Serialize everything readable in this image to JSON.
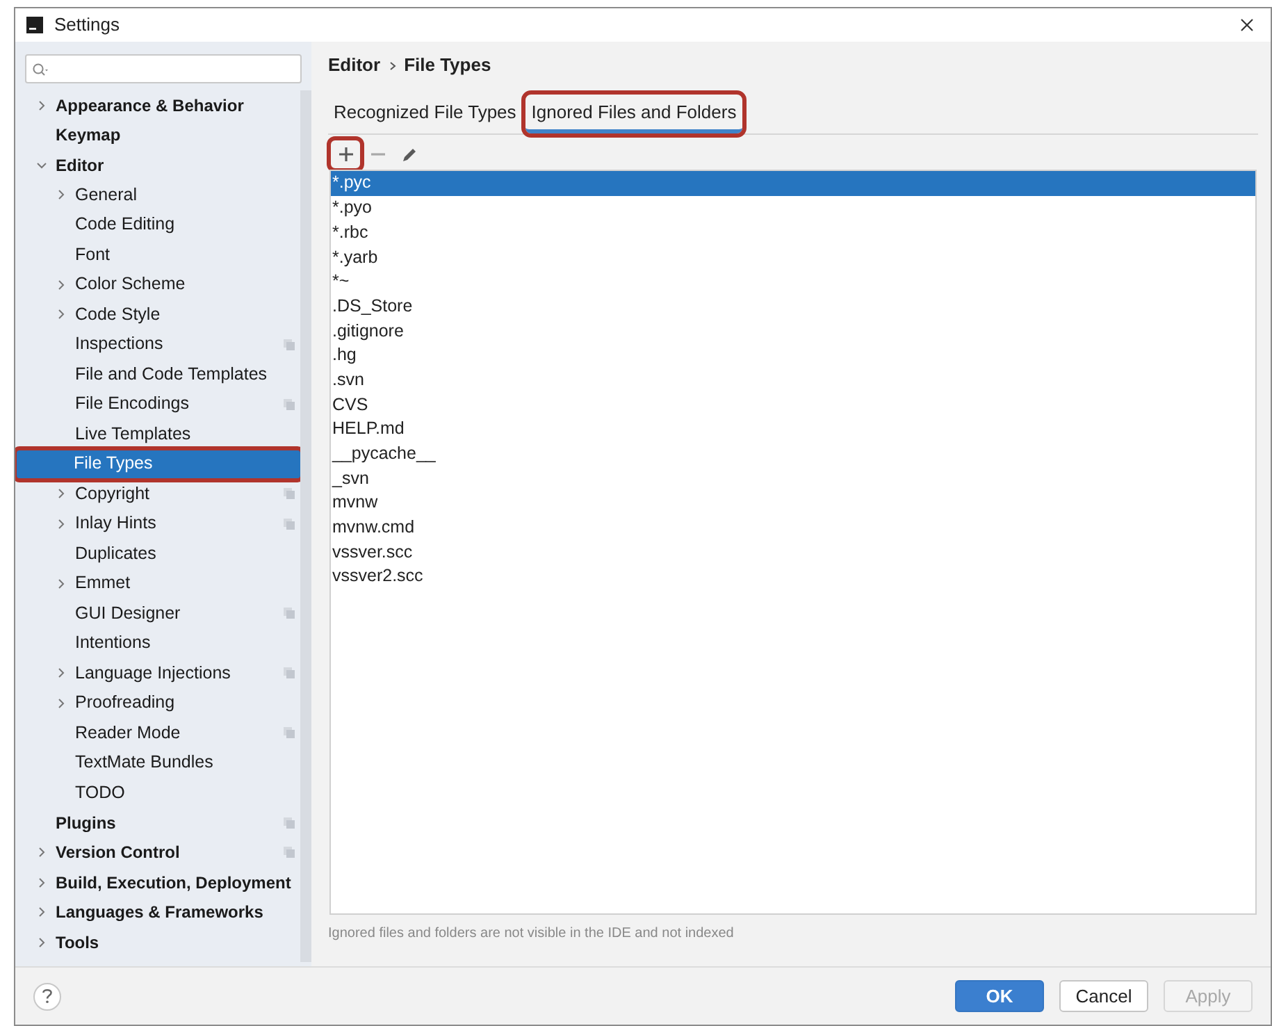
{
  "window": {
    "title": "Settings"
  },
  "sidebar": {
    "items": [
      {
        "label": "Appearance & Behavior",
        "bold": true,
        "expanded": false
      },
      {
        "label": "Keymap",
        "bold": true
      },
      {
        "label": "Editor",
        "bold": true,
        "expanded": true,
        "children": [
          {
            "label": "General",
            "expanded": false
          },
          {
            "label": "Code Editing"
          },
          {
            "label": "Font"
          },
          {
            "label": "Color Scheme",
            "expanded": false
          },
          {
            "label": "Code Style",
            "expanded": false
          },
          {
            "label": "Inspections",
            "project_icon": true
          },
          {
            "label": "File and Code Templates"
          },
          {
            "label": "File Encodings",
            "project_icon": true
          },
          {
            "label": "Live Templates"
          },
          {
            "label": "File Types",
            "selected": true,
            "annotated": true
          },
          {
            "label": "Copyright",
            "expanded": false,
            "project_icon": true
          },
          {
            "label": "Inlay Hints",
            "expanded": false,
            "project_icon": true
          },
          {
            "label": "Duplicates"
          },
          {
            "label": "Emmet",
            "expanded": false
          },
          {
            "label": "GUI Designer",
            "project_icon": true
          },
          {
            "label": "Intentions"
          },
          {
            "label": "Language Injections",
            "expanded": false,
            "project_icon": true
          },
          {
            "label": "Proofreading",
            "expanded": false
          },
          {
            "label": "Reader Mode",
            "project_icon": true
          },
          {
            "label": "TextMate Bundles"
          },
          {
            "label": "TODO"
          }
        ]
      },
      {
        "label": "Plugins",
        "bold": true,
        "project_icon": true
      },
      {
        "label": "Version Control",
        "bold": true,
        "expanded": false,
        "project_icon": true
      },
      {
        "label": "Build, Execution, Deployment",
        "bold": true,
        "expanded": false
      },
      {
        "label": "Languages & Frameworks",
        "bold": true,
        "expanded": false
      },
      {
        "label": "Tools",
        "bold": true,
        "expanded": false
      }
    ]
  },
  "breadcrumb": [
    "Editor",
    "File Types"
  ],
  "tabs": [
    {
      "label": "Recognized File Types",
      "selected": false,
      "annotated": false
    },
    {
      "label": "Ignored Files and Folders",
      "selected": true,
      "annotated": true
    }
  ],
  "toolbar": [
    {
      "kind": "add",
      "disabled": false,
      "annotated": true
    },
    {
      "kind": "remove",
      "disabled": true,
      "annotated": false
    },
    {
      "kind": "edit",
      "disabled": false,
      "annotated": false
    }
  ],
  "patterns": [
    {
      "text": "*.pyc",
      "selected": true
    },
    {
      "text": "*.pyo",
      "selected": false
    },
    {
      "text": "*.rbc",
      "selected": false
    },
    {
      "text": "*.yarb",
      "selected": false
    },
    {
      "text": "*~",
      "selected": false
    },
    {
      "text": ".DS_Store",
      "selected": false
    },
    {
      "text": ".gitignore",
      "selected": false
    },
    {
      "text": ".hg",
      "selected": false
    },
    {
      "text": ".svn",
      "selected": false
    },
    {
      "text": "CVS",
      "selected": false
    },
    {
      "text": "HELP.md",
      "selected": false
    },
    {
      "text": "__pycache__",
      "selected": false
    },
    {
      "text": "_svn",
      "selected": false
    },
    {
      "text": "mvnw",
      "selected": false
    },
    {
      "text": "mvnw.cmd",
      "selected": false
    },
    {
      "text": "vssver.scc",
      "selected": false
    },
    {
      "text": "vssver2.scc",
      "selected": false
    }
  ],
  "hint": "Ignored files and folders are not visible in the IDE and not indexed",
  "buttons": [
    {
      "label": "OK",
      "kind": "primary",
      "disabled": false
    },
    {
      "label": "Cancel",
      "kind": "normal",
      "disabled": false
    },
    {
      "label": "Apply",
      "kind": "normal",
      "disabled": true
    }
  ]
}
